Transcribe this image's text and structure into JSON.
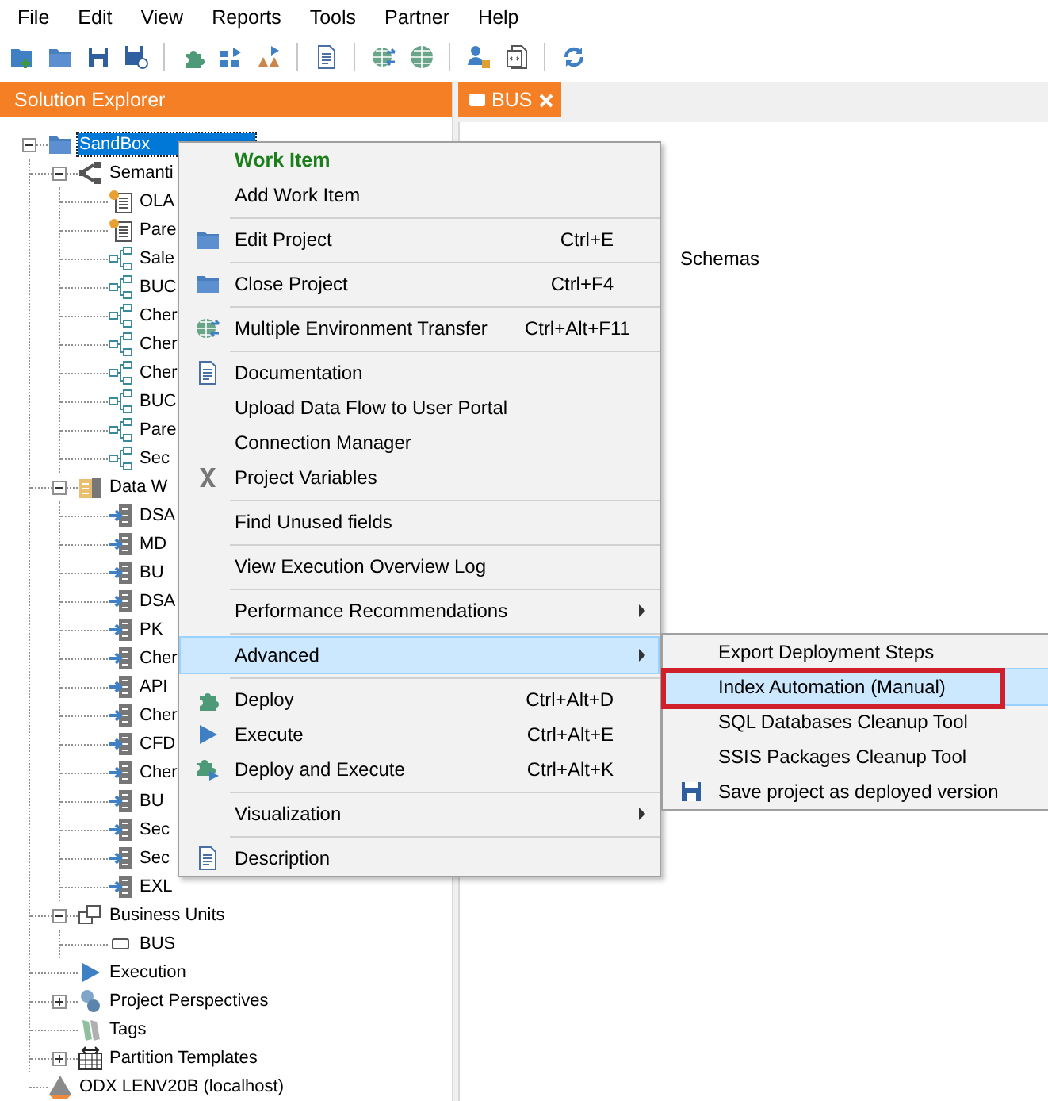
{
  "menubar": [
    "File",
    "Edit",
    "View",
    "Reports",
    "Tools",
    "Partner",
    "Help"
  ],
  "solution_explorer": {
    "title": "Solution Explorer",
    "tree": [
      {
        "label": "SandBox",
        "kind": "folder",
        "selected": true,
        "expanded": true,
        "children": [
          {
            "label": "Semanti",
            "kind": "semantic",
            "selected": false,
            "expanded": true,
            "children": [
              {
                "label": "OLA",
                "kind": "cube",
                "selected": false
              },
              {
                "label": "Pare",
                "kind": "cube",
                "selected": false
              },
              {
                "label": "Sale",
                "kind": "model",
                "selected": false
              },
              {
                "label": "BUC",
                "kind": "model",
                "selected": false
              },
              {
                "label": "Cher",
                "kind": "model",
                "selected": false
              },
              {
                "label": "Cher",
                "kind": "model",
                "selected": false
              },
              {
                "label": "Cher",
                "kind": "model",
                "selected": false
              },
              {
                "label": "BUC",
                "kind": "model",
                "selected": false
              },
              {
                "label": "Pare",
                "kind": "model",
                "selected": false
              },
              {
                "label": "Sec",
                "kind": "model",
                "selected": false
              }
            ]
          },
          {
            "label": "Data W",
            "kind": "warehouse",
            "selected": false,
            "expanded": true,
            "children": [
              {
                "label": "DSA",
                "kind": "table",
                "selected": false
              },
              {
                "label": "MD",
                "kind": "table",
                "selected": false
              },
              {
                "label": "BU",
                "kind": "table",
                "selected": false
              },
              {
                "label": "DSA",
                "kind": "table",
                "selected": false
              },
              {
                "label": "PK",
                "kind": "table",
                "selected": false
              },
              {
                "label": "Cher",
                "kind": "table",
                "selected": false
              },
              {
                "label": "API",
                "kind": "table",
                "selected": false
              },
              {
                "label": "Cher",
                "kind": "table",
                "selected": false
              },
              {
                "label": "CFD",
                "kind": "table",
                "selected": false
              },
              {
                "label": "Cher",
                "kind": "table",
                "selected": false
              },
              {
                "label": "BU",
                "kind": "table",
                "selected": false
              },
              {
                "label": "Sec",
                "kind": "table",
                "selected": false
              },
              {
                "label": "Sec",
                "kind": "table",
                "selected": false
              },
              {
                "label": "EXL",
                "kind": "table",
                "selected": false
              }
            ]
          },
          {
            "label": "Business Units",
            "kind": "units",
            "selected": false,
            "expanded": true,
            "children": [
              {
                "label": "BUS",
                "kind": "unit",
                "selected": false
              }
            ]
          },
          {
            "label": "Execution",
            "kind": "execution",
            "selected": false
          },
          {
            "label": "Project Perspectives",
            "kind": "perspectives",
            "selected": false,
            "expanded": false
          },
          {
            "label": "Tags",
            "kind": "tags",
            "selected": false
          },
          {
            "label": "Partition Templates",
            "kind": "partition",
            "selected": false,
            "expanded": false
          }
        ]
      },
      {
        "label": "ODX LENV20B (localhost)",
        "kind": "odx",
        "selected": false
      }
    ]
  },
  "tabs": [
    {
      "label": "BUS",
      "selected": true
    }
  ],
  "document": {
    "items": [
      "Schemas"
    ]
  },
  "context_menu": {
    "items": [
      {
        "kind": "header",
        "label": "Work Item"
      },
      {
        "kind": "item",
        "label": "Add Work Item",
        "selected": false
      },
      {
        "kind": "separator"
      },
      {
        "kind": "item",
        "label": "Edit Project",
        "shortcut": "Ctrl+E",
        "selected": false
      },
      {
        "kind": "separator"
      },
      {
        "kind": "item",
        "label": "Close Project",
        "shortcut": "Ctrl+F4",
        "selected": false
      },
      {
        "kind": "separator"
      },
      {
        "kind": "item",
        "label": "Multiple Environment Transfer",
        "shortcut": "Ctrl+Alt+F11",
        "selected": false
      },
      {
        "kind": "separator"
      },
      {
        "kind": "item",
        "label": "Documentation",
        "selected": false
      },
      {
        "kind": "item",
        "label": "Upload Data Flow to User Portal",
        "selected": false
      },
      {
        "kind": "item",
        "label": "Connection Manager",
        "selected": false
      },
      {
        "kind": "item",
        "label": "Project Variables",
        "selected": false
      },
      {
        "kind": "separator"
      },
      {
        "kind": "item",
        "label": "Find Unused fields",
        "selected": false
      },
      {
        "kind": "separator"
      },
      {
        "kind": "item",
        "label": "View Execution Overview Log",
        "selected": false
      },
      {
        "kind": "separator"
      },
      {
        "kind": "item",
        "label": "Performance Recommendations",
        "submenu": true,
        "selected": false
      },
      {
        "kind": "separator"
      },
      {
        "kind": "item",
        "label": "Advanced",
        "submenu": true,
        "selected": true
      },
      {
        "kind": "separator"
      },
      {
        "kind": "item",
        "label": "Deploy",
        "shortcut": "Ctrl+Alt+D",
        "selected": false
      },
      {
        "kind": "item",
        "label": "Execute",
        "shortcut": "Ctrl+Alt+E",
        "selected": false
      },
      {
        "kind": "item",
        "label": "Deploy and Execute",
        "shortcut": "Ctrl+Alt+K",
        "selected": false
      },
      {
        "kind": "separator"
      },
      {
        "kind": "item",
        "label": "Visualization",
        "submenu": true,
        "selected": false
      },
      {
        "kind": "separator"
      },
      {
        "kind": "item",
        "label": "Description",
        "selected": false
      }
    ]
  },
  "submenu": {
    "items": [
      {
        "label": "Export Deployment Steps",
        "selected": false,
        "outlined": false
      },
      {
        "label": "Index Automation (Manual)",
        "selected": true,
        "outlined": true
      },
      {
        "label": "SQL Databases Cleanup Tool",
        "selected": false,
        "outlined": false
      },
      {
        "label": "SSIS Packages Cleanup Tool",
        "selected": false,
        "outlined": false
      },
      {
        "label": "Save project as deployed version",
        "selected": false,
        "outlined": false
      }
    ]
  }
}
